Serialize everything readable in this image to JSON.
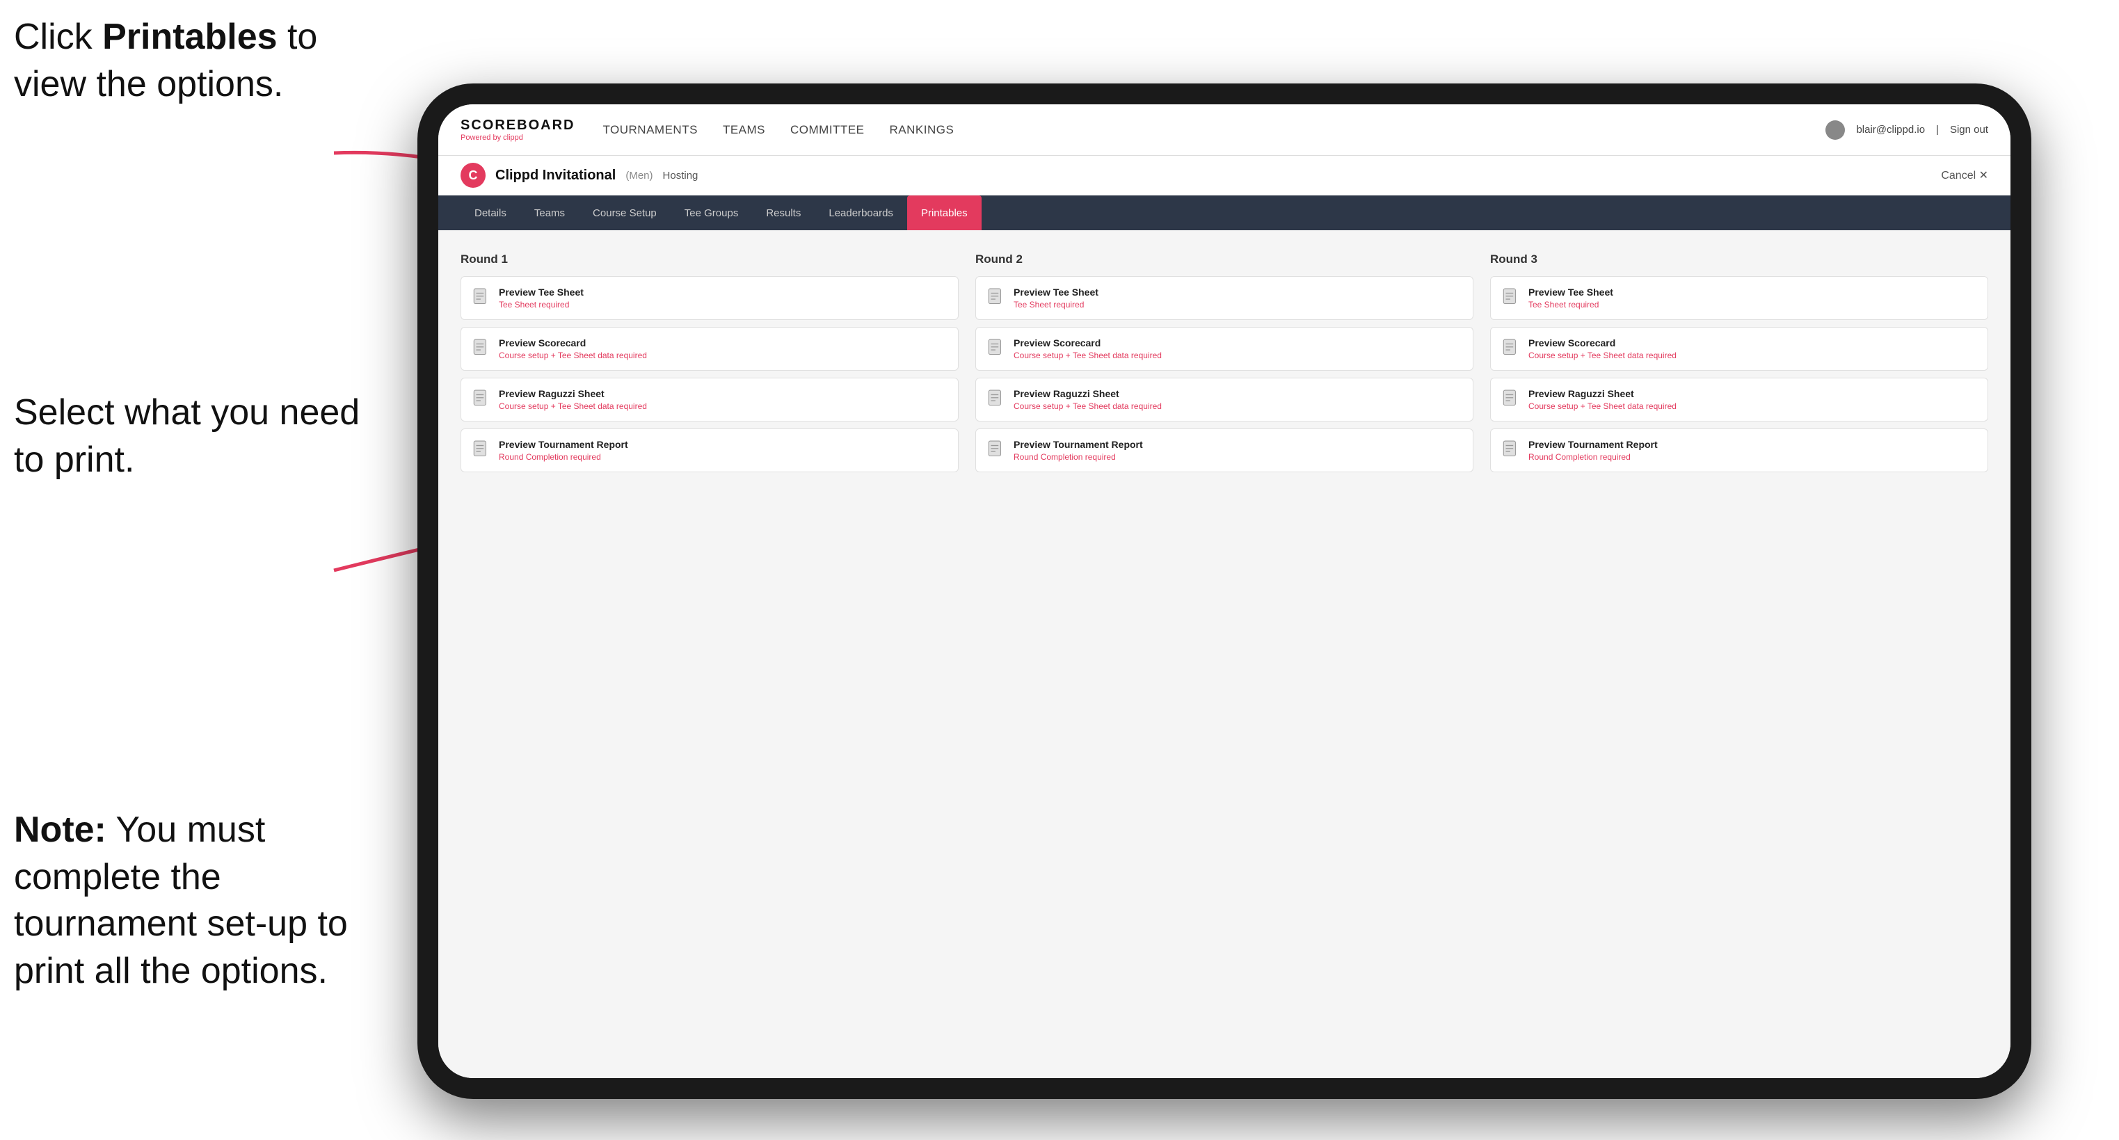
{
  "annotations": {
    "top": {
      "prefix": "Click ",
      "bold": "Printables",
      "suffix": " to\nview the options."
    },
    "middle": {
      "text": "Select what you\nneed to print."
    },
    "bottom": {
      "prefix": "Note:",
      "suffix": " You must\ncomplete the\ntournament set-up\nto print all the options."
    }
  },
  "nav": {
    "brand": "SCOREBOARD",
    "brand_sub": "Powered by clippd",
    "links": [
      {
        "label": "TOURNAMENTS",
        "active": false
      },
      {
        "label": "TEAMS",
        "active": false
      },
      {
        "label": "COMMITTEE",
        "active": false
      },
      {
        "label": "RANKINGS",
        "active": false
      }
    ],
    "user_email": "blair@clippd.io",
    "sign_out": "Sign out"
  },
  "sub_header": {
    "logo_letter": "C",
    "tournament_name": "Clippd Invitational",
    "tournament_tag": "(Men)",
    "hosting": "Hosting",
    "cancel": "Cancel ✕"
  },
  "tabs": [
    {
      "label": "Details",
      "active": false
    },
    {
      "label": "Teams",
      "active": false
    },
    {
      "label": "Course Setup",
      "active": false
    },
    {
      "label": "Tee Groups",
      "active": false
    },
    {
      "label": "Results",
      "active": false
    },
    {
      "label": "Leaderboards",
      "active": false
    },
    {
      "label": "Printables",
      "active": true
    }
  ],
  "rounds": [
    {
      "title": "Round 1",
      "items": [
        {
          "title": "Preview Tee Sheet",
          "subtitle": "Tee Sheet required"
        },
        {
          "title": "Preview Scorecard",
          "subtitle": "Course setup + Tee Sheet data required"
        },
        {
          "title": "Preview Raguzzi Sheet",
          "subtitle": "Course setup + Tee Sheet data required"
        },
        {
          "title": "Preview Tournament Report",
          "subtitle": "Round Completion required"
        }
      ]
    },
    {
      "title": "Round 2",
      "items": [
        {
          "title": "Preview Tee Sheet",
          "subtitle": "Tee Sheet required"
        },
        {
          "title": "Preview Scorecard",
          "subtitle": "Course setup + Tee Sheet data required"
        },
        {
          "title": "Preview Raguzzi Sheet",
          "subtitle": "Course setup + Tee Sheet data required"
        },
        {
          "title": "Preview Tournament Report",
          "subtitle": "Round Completion required"
        }
      ]
    },
    {
      "title": "Round 3",
      "items": [
        {
          "title": "Preview Tee Sheet",
          "subtitle": "Tee Sheet required"
        },
        {
          "title": "Preview Scorecard",
          "subtitle": "Course setup + Tee Sheet data required"
        },
        {
          "title": "Preview Raguzzi Sheet",
          "subtitle": "Course setup + Tee Sheet data required"
        },
        {
          "title": "Preview Tournament Report",
          "subtitle": "Round Completion required"
        }
      ]
    }
  ]
}
